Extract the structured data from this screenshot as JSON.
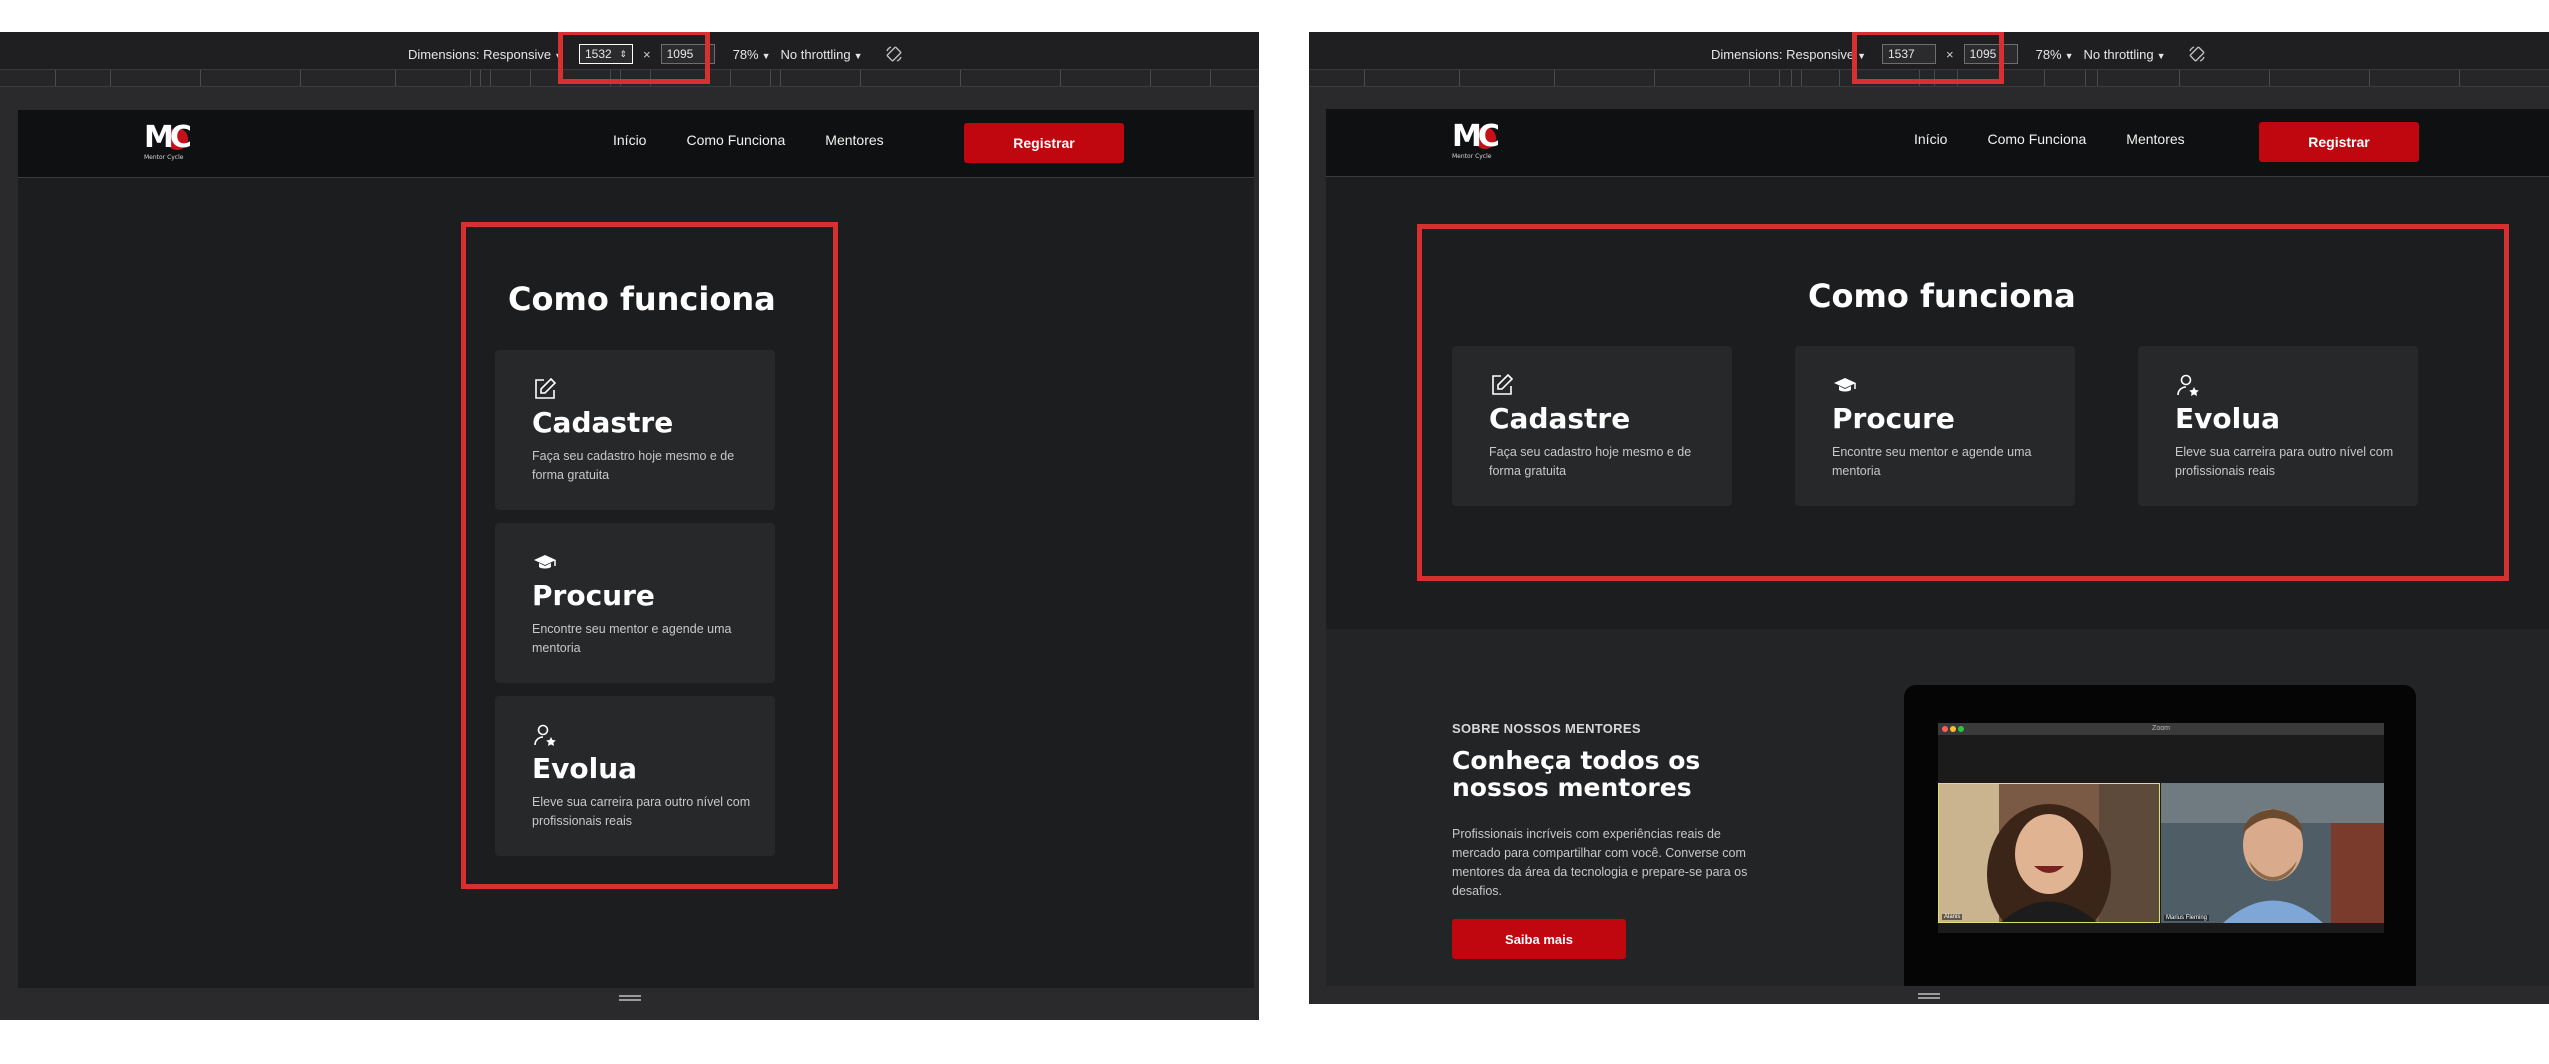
{
  "devtools": {
    "dimensions_label": "Dimensions: Responsive",
    "width_left": "1532",
    "width_right": "1537",
    "height": "1095",
    "times": "×",
    "zoom": "78%",
    "throttling": "No throttling"
  },
  "site": {
    "logo_text": "MC",
    "logo_sub": "Mentor Cycle",
    "nav": {
      "home": "Início",
      "how": "Como Funciona",
      "mentors": "Mentores"
    },
    "register": "Registrar"
  },
  "how_it_works": {
    "title": "Como funciona",
    "cards": [
      {
        "title": "Cadastre",
        "desc": "Faça seu cadastro hoje mesmo e de forma gratuita",
        "icon": "edit-icon"
      },
      {
        "title": "Procure",
        "desc": "Encontre seu mentor e agende uma mentoria",
        "icon": "graduation-cap-icon"
      },
      {
        "title": "Evolua",
        "desc": "Eleve sua carreira para outro nível com profissionais reais",
        "icon": "user-star-icon"
      }
    ]
  },
  "mentors": {
    "kicker": "SOBRE NOSSOS MENTORES",
    "title": "Conheça todos os nossos mentores",
    "desc": "Profissionais incríveis com experiências reais de mercado para compartilhar com você. Converse com mentores da área da tecnologia e prepare-se para os desafios.",
    "button": "Saiba mais",
    "zoom_title": "Zoom",
    "tile_left": "Alanis",
    "tile_right": "Marius Fleming"
  },
  "colors": {
    "accent": "#c0060f",
    "highlight": "#d63030"
  }
}
